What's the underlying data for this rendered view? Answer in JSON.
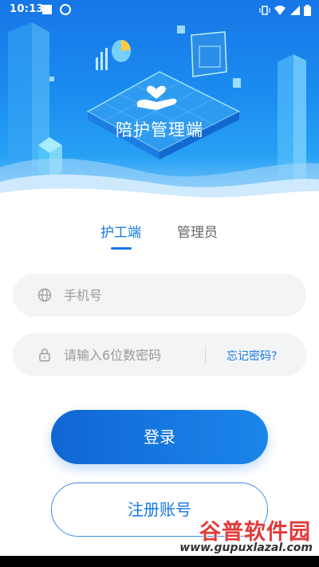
{
  "status_bar": {
    "time": "10:13"
  },
  "hero": {
    "title": "陪护管理端"
  },
  "tabs": [
    {
      "label": "护工端",
      "active": true
    },
    {
      "label": "管理员",
      "active": false
    }
  ],
  "phone_field": {
    "placeholder": "手机号",
    "value": "",
    "icon": "globe-icon"
  },
  "password_field": {
    "placeholder": "请输入6位数密码",
    "value": "",
    "icon": "lock-icon"
  },
  "forgot_password": "忘记密码?",
  "login_button": "登录",
  "register_button": "注册账号",
  "watermark": {
    "name": "谷普软件园",
    "url": "www.gupuxlazal.com"
  },
  "colors": {
    "accent": "#1677e3",
    "hero_top": "#1676e6",
    "field_bg": "#f3f4f6"
  }
}
